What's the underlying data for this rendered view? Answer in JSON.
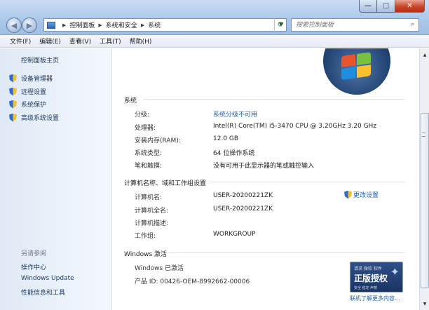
{
  "window": {
    "controls": {
      "minimize": "—",
      "maximize": "□",
      "close": "✕"
    }
  },
  "address": {
    "crumbs": [
      "控制面板",
      "系统和安全",
      "系统"
    ]
  },
  "search": {
    "placeholder": "搜索控制面板"
  },
  "menu": [
    "文件(F)",
    "编辑(E)",
    "查看(V)",
    "工具(T)",
    "帮助(H)"
  ],
  "sidebar": {
    "home": "控制面板主页",
    "links": [
      "设备管理器",
      "远程设置",
      "系统保护",
      "高级系统设置"
    ],
    "see_also": "另请参阅",
    "bottom_links": [
      "操作中心",
      "Windows Update",
      "性能信息和工具"
    ]
  },
  "system": {
    "title": "系统",
    "rows": [
      {
        "label": "分级:",
        "value": "系统分级不可用",
        "is_link": true
      },
      {
        "label": "处理器:",
        "value": "Intel(R) Core(TM) i5-3470 CPU @ 3.20GHz   3.20 GHz"
      },
      {
        "label": "安装内存(RAM):",
        "value": "12.0 GB"
      },
      {
        "label": "系统类型:",
        "value": "64 位操作系统"
      },
      {
        "label": "笔和触摸:",
        "value": "没有可用于此显示器的笔或触控输入"
      }
    ]
  },
  "computer": {
    "title": "计算机名称、域和工作组设置",
    "change_settings": "更改设置",
    "rows": [
      {
        "label": "计算机名:",
        "value": "USER-20200221ZK"
      },
      {
        "label": "计算机全名:",
        "value": "USER-20200221ZK"
      },
      {
        "label": "计算机描述:",
        "value": ""
      },
      {
        "label": "工作组:",
        "value": "WORKGROUP"
      }
    ]
  },
  "activation": {
    "title": "Windows 激活",
    "status": "Windows 已激活",
    "product_id": "产品 ID: 00426-OEM-8992662-00006",
    "badge_top": "请求 微软 软件",
    "badge_main": "正版授权",
    "badge_bottom": "安全 稳定 声誉",
    "learn_more": "联机了解更多内容..."
  },
  "colors": {
    "link": "#1a5fb4",
    "sidebar_bg": "#eef4fb",
    "title_bar": "#a9c7e9"
  }
}
